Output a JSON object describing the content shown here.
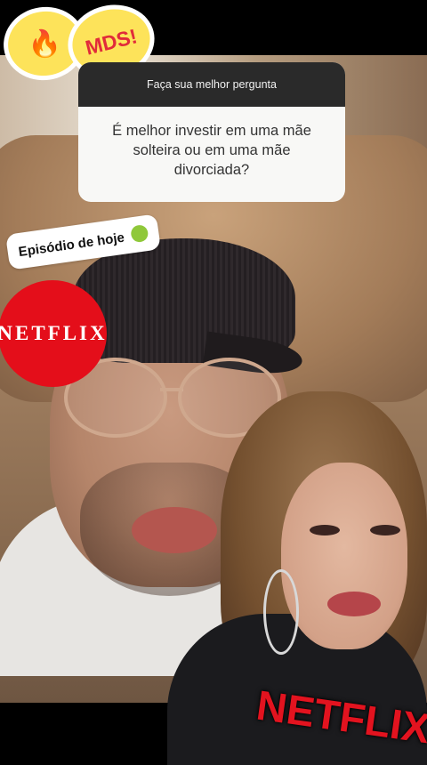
{
  "question_box": {
    "header": "Faça sua melhor pergunta",
    "question": "É melhor investir em uma mãe solteira ou em uma mãe divorciada?"
  },
  "stickers": {
    "fire_icon": "fire-emoji",
    "mds": "MDS!",
    "episode_label": "Episódio de hoje",
    "episode_icon": "nauseated-face-emoji",
    "netflix_small": "NETFLIX",
    "netflix_big": "NETFLIX"
  },
  "colors": {
    "netflix_red": "#e40e1a",
    "sticker_yellow": "#fde35a"
  }
}
